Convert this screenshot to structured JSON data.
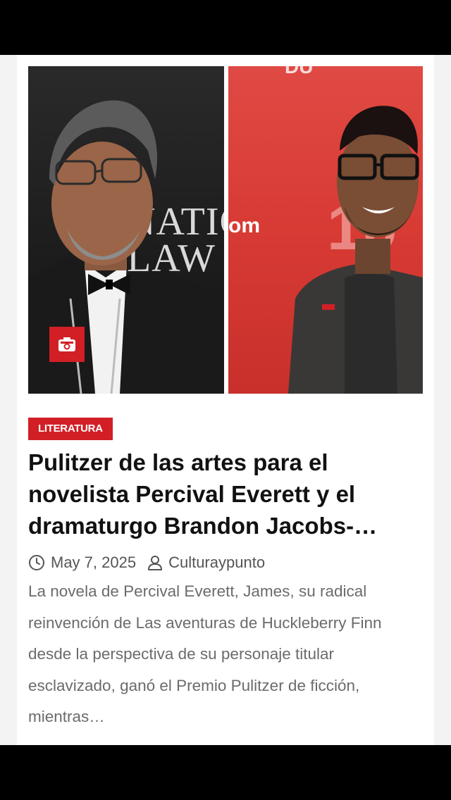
{
  "post": {
    "image": {
      "left_background_text": "NATIO\nLAW",
      "right_background_text": "om"
    },
    "category": "LITERATURA",
    "title": "Pulitzer de las artes para el novelista Percival Everett y el dramaturgo Brandon Jacobs-…",
    "date": "May 7, 2025",
    "author": "Culturaypunto",
    "excerpt": "La novela de Percival Everett, James, su radical reinvención de Las aventuras de Huckleberry Finn desde la perspectiva de su personaje titular esclavizado, ganó el Premio Pulitzer de ficción, mientras…",
    "icons": {
      "media": "camera-icon",
      "date": "clock-icon",
      "author": "user-icon"
    }
  },
  "colors": {
    "accent": "#d21f26",
    "title": "#111111",
    "meta": "#555555",
    "excerpt": "#6b6b6b",
    "card_bg": "#ffffff",
    "page_bg": "#f3f3f3"
  }
}
